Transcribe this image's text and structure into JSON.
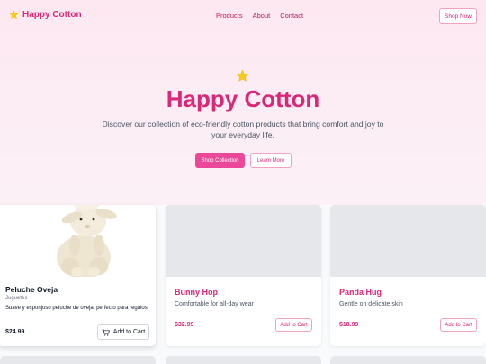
{
  "nav": {
    "brand": "Happy Cotton",
    "links": [
      "Products",
      "About",
      "Contact"
    ],
    "cta": "Shop Now"
  },
  "hero": {
    "title": "Happy Cotton",
    "text": "Discover our collection of eco-friendly cotton products that bring comfort and joy to your everyday life.",
    "primary_button": "Shop Collection",
    "secondary_button": "Learn More"
  },
  "products": [
    {
      "name": "Peluche Oveja",
      "category": "Juguetes",
      "description": "Suave y esponjoso peluche de oveja, perfecto para regalos",
      "price": "$24.99",
      "button": "Add to Cart",
      "image": "plush-sheep"
    },
    {
      "name": "Bunny Hop",
      "description": "Comfortable for all-day wear",
      "price": "$32.99",
      "button": "Add to Cart"
    },
    {
      "name": "Panda Hug",
      "description": "Gentle on delicate skin",
      "price": "$18.99",
      "button": "Add to Cart"
    }
  ],
  "colors": {
    "brand": "#db2777",
    "accent": "#ec4899",
    "star": "#facc15",
    "placeholder": "#e5e7eb"
  },
  "icons": [
    "star-icon",
    "cart-icon"
  ]
}
